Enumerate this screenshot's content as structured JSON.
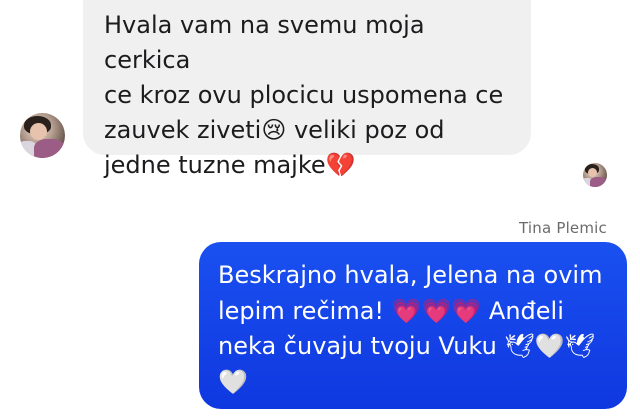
{
  "conversation": {
    "incoming_message": {
      "text": "Hvala vam na svemu moja cerkica\nce kroz ovu plocicu uspomena ce\nzauvek ziveti😢 veliki poz od\njedne tuzne majke💔"
    },
    "outgoing_message": {
      "sender_name": "Tina Plemic",
      "text": "Beskrajno hvala, Jelena na ovim\nlepim rečima! 💗💗💗 Anđeli\nneka čuvaju tvoju Vuku 🕊🤍🕊\n🤍"
    }
  },
  "colors": {
    "incoming_bubble": "#f0f0f0",
    "outgoing_bubble": "#1546ea",
    "sender_name_text": "#6b6b6b"
  }
}
